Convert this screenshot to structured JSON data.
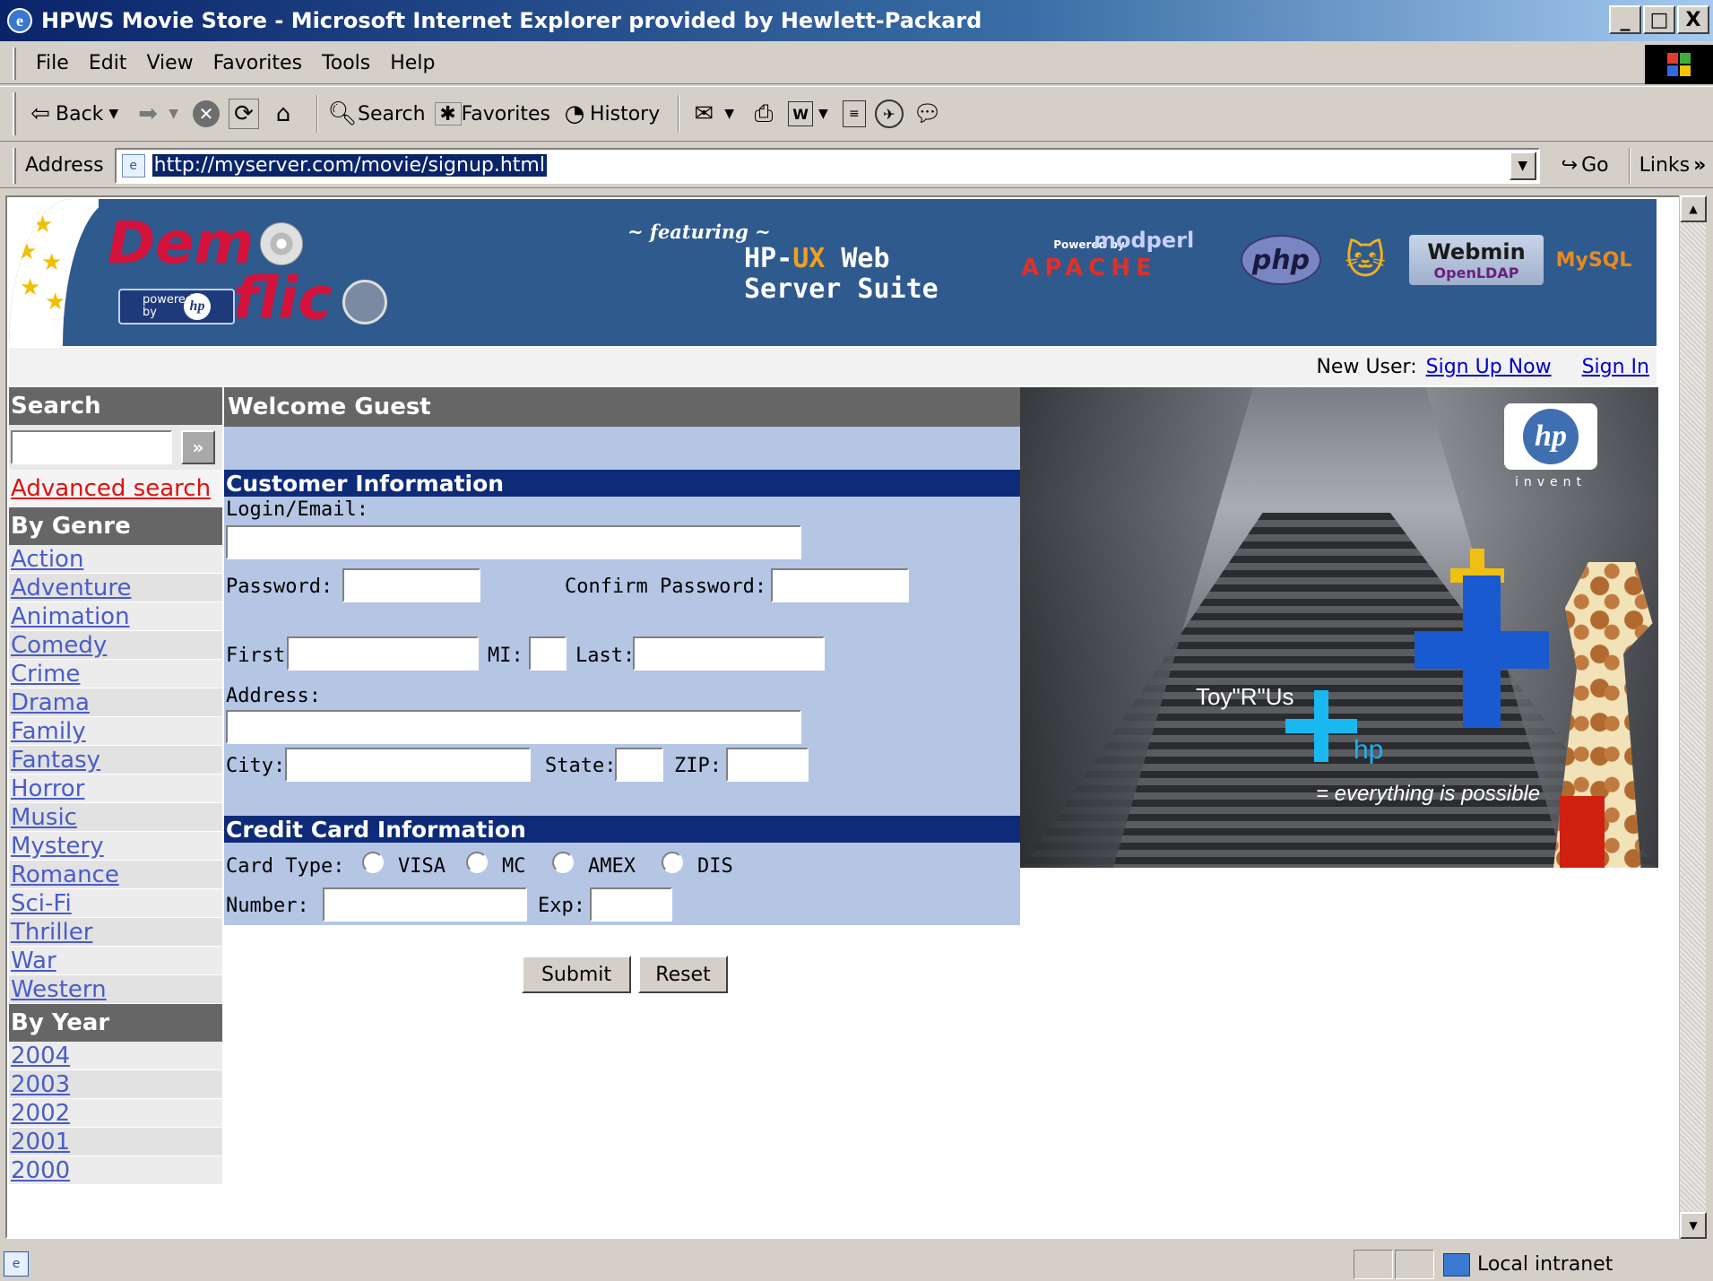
{
  "window": {
    "title": "HPWS Movie Store - Microsoft Internet Explorer provided by Hewlett-Packard",
    "controls": [
      "_",
      "□",
      "X"
    ]
  },
  "menu": [
    "File",
    "Edit",
    "View",
    "Favorites",
    "Tools",
    "Help"
  ],
  "toolbar": {
    "back": "Back",
    "search": "Search",
    "favorites": "Favorites",
    "history": "History"
  },
  "address": {
    "label": "Address",
    "url": "http://myserver.com/movie/signup.html",
    "go": "Go",
    "links": "Links"
  },
  "banner": {
    "demo": "Dem",
    "flic": "flic",
    "powered": "powered by",
    "hp_logo": "hp",
    "featuring": "~ featuring ~",
    "suite_line1_a": "HP-",
    "suite_line1_b": "UX",
    "suite_line1_c": " Web",
    "suite_line2": "Server Suite",
    "apache_top": "Powered by",
    "apache": "APACHE",
    "modperl": "modperl",
    "php": "php",
    "webmin": "Webmin",
    "openldap": "OpenLDAP",
    "mysql": "MySQL"
  },
  "signbar": {
    "new_user": "New User:",
    "signup": "Sign Up Now",
    "signin": "Sign In"
  },
  "sidebar": {
    "search_title": "Search",
    "go_symbol": "»",
    "advanced": "Advanced search",
    "genre_title": "By Genre",
    "genres": [
      "Action",
      "Adventure",
      "Animation",
      "Comedy",
      "Crime",
      "Drama",
      "Family",
      "Fantasy",
      "Horror",
      "Music",
      "Mystery",
      "Romance",
      "Sci-Fi",
      "Thriller",
      "War",
      "Western"
    ],
    "year_title": "By Year",
    "years": [
      "2004",
      "2003",
      "2002",
      "2001",
      "2000"
    ]
  },
  "form": {
    "welcome": "Welcome Guest",
    "customer_header": "Customer Information",
    "login_label": "Login/Email:",
    "password_label": "Password:",
    "confirm_label": "Confirm Password:",
    "first_label": "First:",
    "mi_label": "MI:",
    "last_label": "Last:",
    "address_label": "Address:",
    "city_label": "City:",
    "state_label": "State:",
    "zip_label": "ZIP:",
    "card_header": "Credit Card Information",
    "card_type_label": "Card Type:",
    "card_types": [
      "VISA",
      "MC",
      "AMEX",
      "DIS"
    ],
    "number_label": "Number:",
    "exp_label": "Exp:",
    "submit": "Submit",
    "reset": "Reset"
  },
  "ad": {
    "hp": "hp",
    "invent": "invent",
    "toyrus": "Toy\"R\"Us",
    "hp_small": "hp",
    "tagline": "= everything is possible"
  },
  "status": {
    "zone": "Local intranet"
  }
}
